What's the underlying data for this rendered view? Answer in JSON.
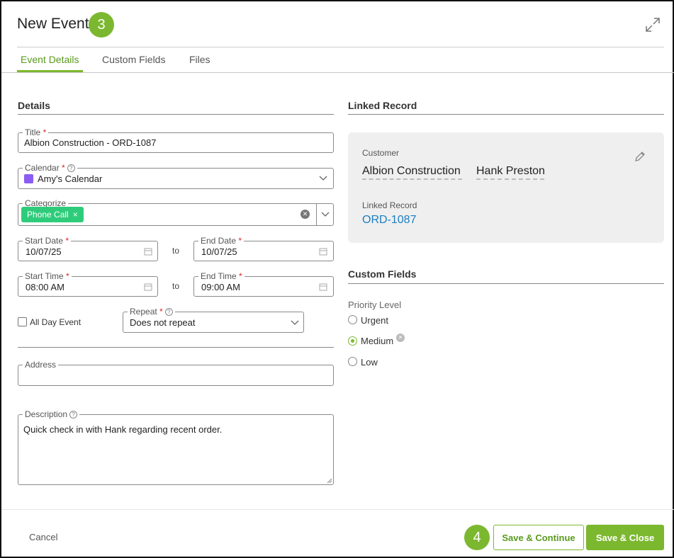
{
  "header": {
    "title": "New Event",
    "step_badge": "3",
    "expand_icon": "expand-arrows-icon"
  },
  "tabs": [
    {
      "label": "Event Details",
      "active": true
    },
    {
      "label": "Custom Fields",
      "active": false
    },
    {
      "label": "Files",
      "active": false
    }
  ],
  "details": {
    "section_title": "Details",
    "title_field": {
      "label": "Title",
      "required": "*",
      "value": "Albion Construction - ORD-1087"
    },
    "calendar_field": {
      "label": "Calendar",
      "required": "*",
      "value": "Amy's Calendar",
      "color": "#8b5cf6"
    },
    "categorize_field": {
      "label": "Categorize",
      "chip": "Phone Call",
      "chip_remove": "×",
      "chip_color": "#2ecc7a"
    },
    "start_date": {
      "label": "Start Date",
      "required": "*",
      "value": "10/07/25"
    },
    "end_date": {
      "label": "End Date",
      "required": "*",
      "value": "10/07/25"
    },
    "start_time": {
      "label": "Start Time",
      "required": "*",
      "value": "08:00 AM"
    },
    "end_time": {
      "label": "End Time",
      "required": "*",
      "value": "09:00 AM"
    },
    "to_label": "to",
    "all_day": {
      "label": "All Day Event",
      "checked": false
    },
    "repeat_field": {
      "label": "Repeat",
      "required": "*",
      "value": "Does not repeat"
    },
    "address_field": {
      "label": "Address",
      "value": ""
    },
    "description_field": {
      "label": "Description",
      "value": "Quick check in with Hank regarding recent order."
    }
  },
  "linked_record": {
    "section_title": "Linked Record",
    "customer_label": "Customer",
    "customer_company": "Albion Construction",
    "customer_contact": "Hank Preston",
    "record_label": "Linked Record",
    "record_value": "ORD-1087",
    "edit_icon": "pencil-icon"
  },
  "custom_fields": {
    "section_title": "Custom Fields",
    "priority_label": "Priority Level",
    "options": [
      {
        "label": "Urgent",
        "selected": false
      },
      {
        "label": "Medium",
        "selected": true
      },
      {
        "label": "Low",
        "selected": false
      }
    ]
  },
  "footer": {
    "cancel_label": "Cancel",
    "step_badge": "4",
    "save_continue_label": "Save & Continue",
    "save_close_label": "Save & Close"
  },
  "colors": {
    "accent": "#7cb82f",
    "link": "#1a7fc1",
    "required": "#d22222"
  }
}
